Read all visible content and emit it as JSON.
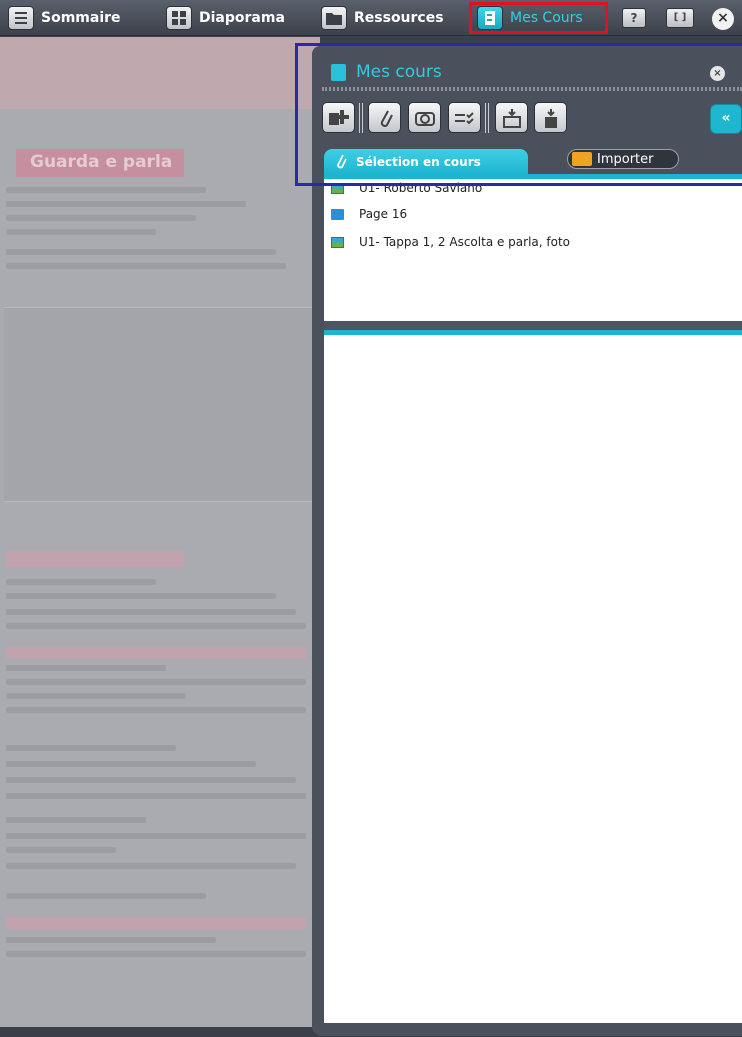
{
  "toolbar": {
    "sommaire": "Sommaire",
    "diaporama": "Diaporama",
    "ressources": "Ressources",
    "mes_cours": "Mes Cours",
    "help": "?",
    "fullscreen": "[ ]",
    "close": "×"
  },
  "background_page": {
    "title": "Guarda e parla"
  },
  "panel": {
    "title": "Mes cours",
    "close": "×",
    "collapse": "«",
    "tab_label": "Sélection en cours",
    "import_label": "Importer",
    "items": [
      {
        "icon": "image-icon",
        "label": "U1- Roberto Saviano"
      },
      {
        "icon": "page-icon",
        "label": "Page 16"
      },
      {
        "icon": "image-icon",
        "label": "U1- Tappa 1, 2 Ascolta e parla, foto"
      }
    ]
  },
  "colors": {
    "accent": "#1db4cf",
    "highlight_red": "#e2111e",
    "selection_blue": "#2b2aa6"
  }
}
